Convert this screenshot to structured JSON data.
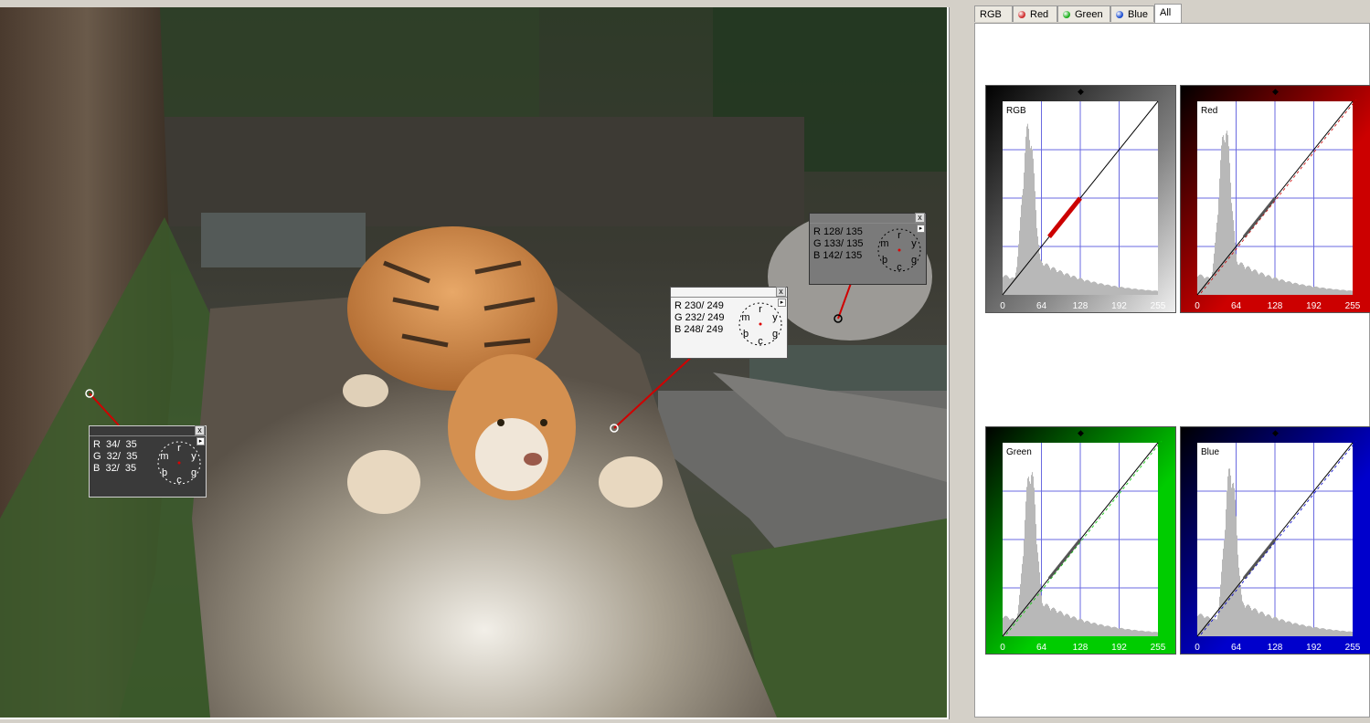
{
  "tabs": [
    {
      "label": "RGB",
      "dot": ""
    },
    {
      "label": "Red",
      "dot": "#d03030"
    },
    {
      "label": "Green",
      "dot": "#20b020"
    },
    {
      "label": "Blue",
      "dot": "#2050d0"
    },
    {
      "label": "All",
      "dot": ""
    }
  ],
  "active_tab": "All",
  "probes": [
    {
      "r": "R  34/  35",
      "g": "G  32/  35",
      "b": "B  32/  35",
      "close": "x"
    },
    {
      "r": "R 230/ 249",
      "g": "G 232/ 249",
      "b": "B 248/ 249",
      "close": "x"
    },
    {
      "r": "R 128/ 135",
      "g": "G 133/ 135",
      "b": "B 142/ 135",
      "close": "x"
    }
  ],
  "dial_letters": [
    "r",
    "y",
    "g",
    "c",
    "b",
    "m"
  ],
  "histograms": [
    {
      "label": "RGB",
      "color": "#808080"
    },
    {
      "label": "Red",
      "color": "#cc0000"
    },
    {
      "label": "Green",
      "color": "#00cc00"
    },
    {
      "label": "Blue",
      "color": "#0000cc"
    }
  ],
  "axis_ticks": [
    "0",
    "64",
    "128",
    "192",
    "255"
  ],
  "colors": {
    "accent_red": "#cc0000",
    "curve": "#000000",
    "grid": "#6a6ae0",
    "hist_bar": "#b8b8b8"
  }
}
